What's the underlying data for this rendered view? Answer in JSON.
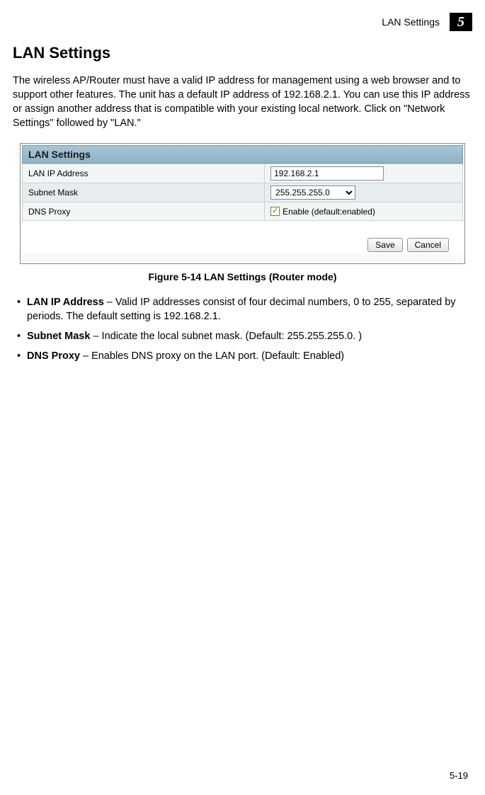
{
  "header": {
    "label": "LAN Settings",
    "chapter": "5"
  },
  "section_title": "LAN Settings",
  "intro_paragraph": "The wireless AP/Router must have a valid IP address for management using a web browser and to support other features. The unit has a default IP address of 192.168.2.1. You can use this IP address or assign another address that is compatible with your existing local network. Click on \"Network Settings\" followed by \"LAN.\"",
  "panel": {
    "title": "LAN Settings",
    "rows": {
      "lan_ip": {
        "label": "LAN IP Address",
        "value": "192.168.2.1"
      },
      "subnet": {
        "label": "Subnet Mask",
        "value": "255.255.255.0"
      },
      "dns_proxy": {
        "label": "DNS Proxy",
        "text": "Enable (default:enabled)",
        "checked": true
      }
    },
    "buttons": {
      "save": "Save",
      "cancel": "Cancel"
    }
  },
  "figure_caption": "Figure 5-14  LAN Settings (Router mode)",
  "bullets": {
    "lan_ip": {
      "term": "LAN IP Address",
      "text": " – Valid IP addresses consist of four decimal numbers, 0 to 255, separated by periods. The default setting is 192.168.2.1."
    },
    "subnet": {
      "term": "Subnet Mask",
      "text": " – Indicate the local subnet mask. (Default: 255.255.255.0. )"
    },
    "dns_proxy": {
      "term": "DNS Proxy",
      "text": " – Enables DNS proxy on the LAN port. (Default: Enabled)"
    }
  },
  "page_number": "5-19"
}
